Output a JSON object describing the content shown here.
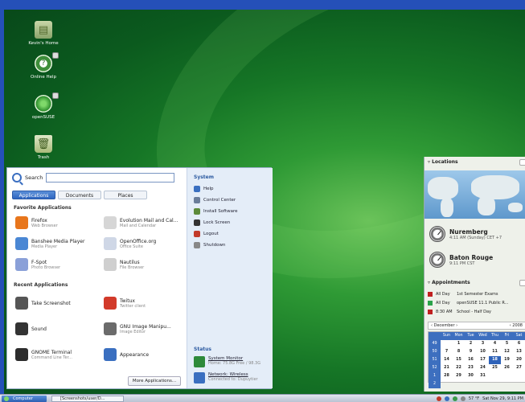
{
  "desktop_icons": [
    {
      "label": "Kevin's Home",
      "icon": "home-folder-icon"
    },
    {
      "label": "Online Help",
      "icon": "help-icon"
    },
    {
      "label": "openSUSE",
      "icon": "opensuse-icon"
    },
    {
      "label": "Trash",
      "icon": "trash-icon"
    }
  ],
  "menu": {
    "search_label": "Search",
    "search_value": "",
    "tabs": [
      "Applications",
      "Documents",
      "Places"
    ],
    "favorites_heading": "Favorite Applications",
    "favorites": [
      {
        "name": "Firefox",
        "desc": "Web Browser",
        "icon": "firefox-icon",
        "color": "#e8761c"
      },
      {
        "name": "Evolution Mail and Cal...",
        "desc": "Mail and Calendar",
        "icon": "evolution-icon",
        "color": "#d6d6d6"
      },
      {
        "name": "Banshee Media Player",
        "desc": "Media Player",
        "icon": "banshee-icon",
        "color": "#4a87d4"
      },
      {
        "name": "OpenOffice.org",
        "desc": "Office Suite",
        "icon": "openoffice-icon",
        "color": "#cfd7e6"
      },
      {
        "name": "F-Spot",
        "desc": "Photo Browser",
        "icon": "fspot-icon",
        "color": "#8aa0d8"
      },
      {
        "name": "Nautilus",
        "desc": "File Browser",
        "icon": "nautilus-icon",
        "color": "#cfcfcf"
      }
    ],
    "recent_heading": "Recent Applications",
    "recent": [
      {
        "name": "Take Screenshot",
        "desc": "",
        "icon": "camera-icon",
        "color": "#555"
      },
      {
        "name": "Twitux",
        "desc": "Twitter client",
        "icon": "twitux-icon",
        "color": "#d23a2a"
      },
      {
        "name": "Sound",
        "desc": "",
        "icon": "sound-icon",
        "color": "#333"
      },
      {
        "name": "GNU Image Manipu...",
        "desc": "Image Editor",
        "icon": "gimp-icon",
        "color": "#6b6b6b"
      },
      {
        "name": "GNOME Terminal",
        "desc": "Command Line Ter...",
        "icon": "terminal-icon",
        "color": "#2c2c2c"
      },
      {
        "name": "Appearance",
        "desc": "",
        "icon": "appearance-icon",
        "color": "#3a6fc0"
      }
    ],
    "more_button": "More Applications...",
    "system_heading": "System",
    "system_items": [
      {
        "label": "Help",
        "icon": "help-icon",
        "color": "#3a6fc0"
      },
      {
        "label": "Control Center",
        "icon": "control-center-icon",
        "color": "#6a7d9a"
      },
      {
        "label": "Install Software",
        "icon": "install-software-icon",
        "color": "#5c8a3a"
      },
      {
        "label": "Lock Screen",
        "icon": "lock-screen-icon",
        "color": "#333"
      },
      {
        "label": "Logout",
        "icon": "logout-icon",
        "color": "#c23a2a"
      },
      {
        "label": "Shutdown",
        "icon": "shutdown-icon",
        "color": "#888"
      }
    ],
    "status_heading": "Status",
    "status_items": [
      {
        "name": "System Monitor",
        "desc": "Home: 75.8G Free / 98.3G",
        "icon": "system-monitor-icon",
        "color": "#2e8a3a"
      },
      {
        "name": "Network: Wireless",
        "desc": "Connected to: Dupuytier",
        "icon": "network-icon",
        "color": "#3a6fc0"
      }
    ]
  },
  "widget": {
    "locations_heading": "Locations",
    "locations": [
      {
        "city": "Nuremberg",
        "time": "4:11 AM (Sunday) CET +7"
      },
      {
        "city": "Baton Rouge",
        "time": "9:11 PM CST"
      }
    ],
    "appointments_heading": "Appointments",
    "appointments": [
      {
        "time": "All Day",
        "title": "1st Semester Exams",
        "color": "#c02020"
      },
      {
        "time": "All Day",
        "title": "openSUSE 11.1 Public R...",
        "color": "#2aa34a"
      },
      {
        "time": "8:30 AM",
        "title": "School - Half Day",
        "color": "#c02020"
      }
    ],
    "calendar": {
      "month": "December",
      "year": "2008",
      "day_headers": [
        "Sun",
        "Mon",
        "Tue",
        "Wed",
        "Thu",
        "Fri",
        "Sat"
      ],
      "weeks": [
        {
          "wk": "49",
          "days": [
            "",
            "1",
            "2",
            "3",
            "4",
            "5",
            "6"
          ]
        },
        {
          "wk": "50",
          "days": [
            "7",
            "8",
            "9",
            "10",
            "11",
            "12",
            "13"
          ]
        },
        {
          "wk": "51",
          "days": [
            "14",
            "15",
            "16",
            "17",
            "18",
            "19",
            "20"
          ]
        },
        {
          "wk": "52",
          "days": [
            "21",
            "22",
            "23",
            "24",
            "25",
            "26",
            "27"
          ]
        },
        {
          "wk": "1",
          "days": [
            "28",
            "29",
            "30",
            "31",
            "",
            "",
            ""
          ]
        },
        {
          "wk": "2",
          "days": [
            "",
            "",
            "",
            "",
            "",
            "",
            ""
          ]
        }
      ],
      "selected": "18"
    }
  },
  "taskbar": {
    "start_label": "Computer",
    "task_label": "[Screenshots/user/D...",
    "temperature": "57 °F",
    "clock": "Sat Nov 29,  9:11 PM"
  }
}
